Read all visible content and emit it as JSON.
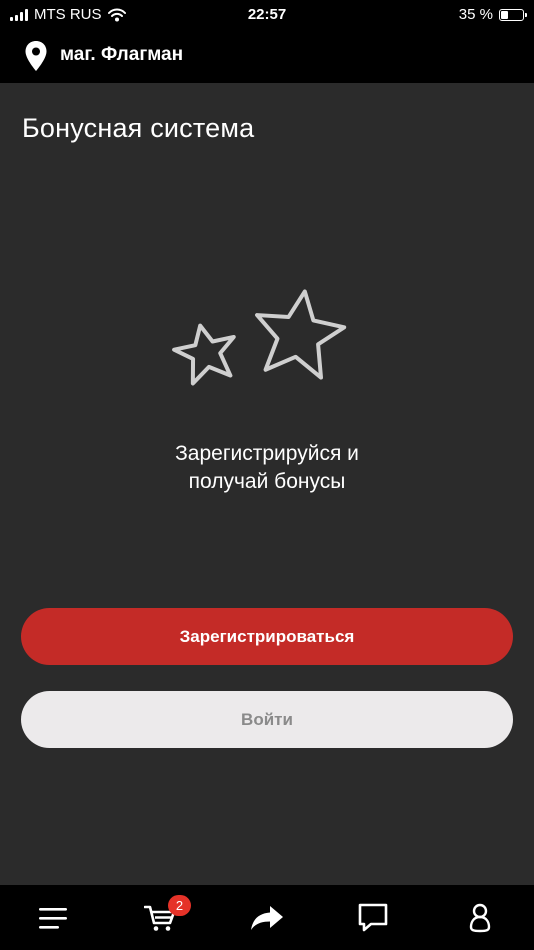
{
  "status_bar": {
    "carrier": "MTS RUS",
    "time": "22:57",
    "battery_percent": "35 %",
    "battery_level": 0.35,
    "icons": [
      "signal-icon",
      "wifi-icon",
      "battery-icon"
    ]
  },
  "header": {
    "store_name": "маг. Флагман",
    "icon": "location-pin-icon"
  },
  "main": {
    "title": "Бонусная система",
    "illustration": "stars-icon",
    "promo_line1": "Зарегистрируйся и",
    "promo_line2": "получай бонусы",
    "register_label": "Зарегистрироваться",
    "login_label": "Войти"
  },
  "tab_bar": {
    "items": [
      {
        "icon": "menu-icon"
      },
      {
        "icon": "cart-icon",
        "badge": "2"
      },
      {
        "icon": "share-icon"
      },
      {
        "icon": "chat-icon"
      },
      {
        "icon": "profile-icon"
      }
    ]
  },
  "colors": {
    "background": "#2b2b2b",
    "bars": "#000000",
    "primary_button": "#c42b27",
    "secondary_button": "#eceaeb",
    "badge": "#e53228"
  }
}
